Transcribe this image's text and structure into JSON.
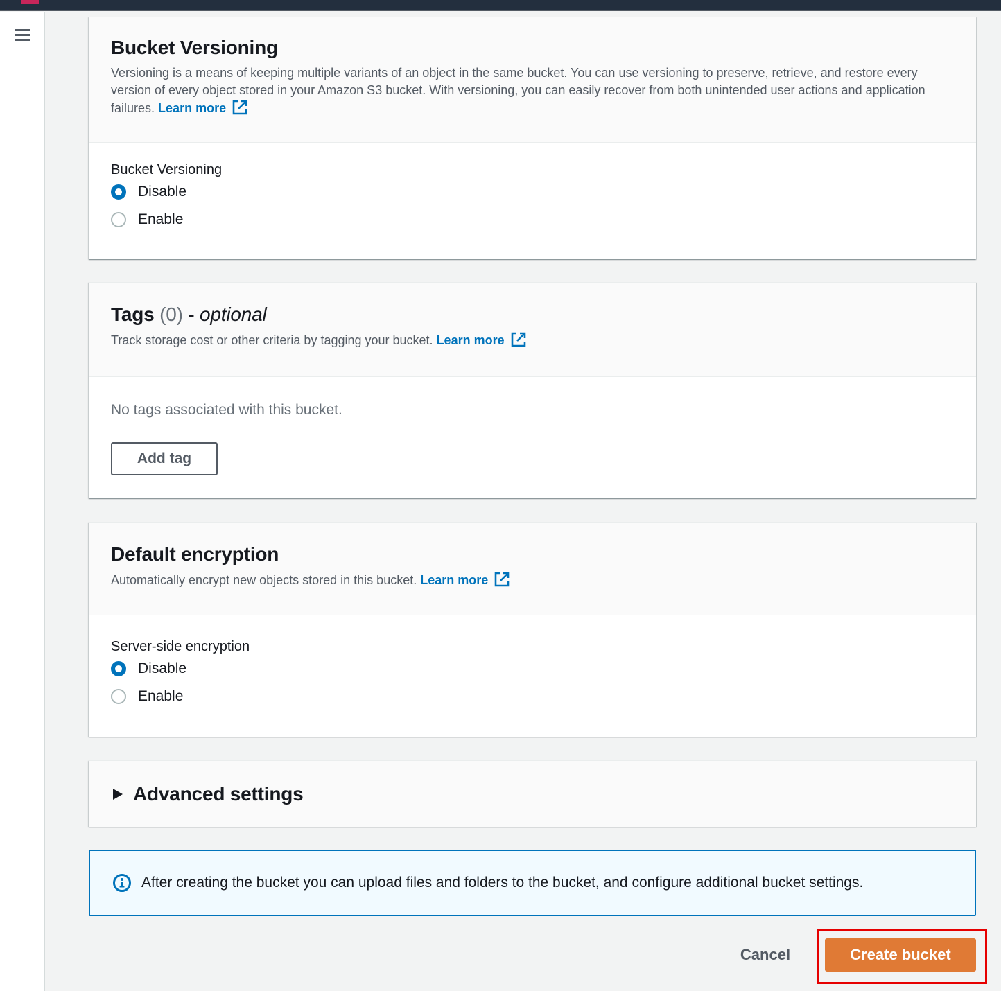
{
  "topbar": {
    "logo": "aws-logo"
  },
  "sidebar": {
    "menu_icon": "hamburger-menu-icon"
  },
  "versioning": {
    "title": "Bucket Versioning",
    "description": "Versioning is a means of keeping multiple variants of an object in the same bucket. You can use versioning to preserve, retrieve, and restore every version of every object stored in your Amazon S3 bucket. With versioning, you can easily recover from both unintended user actions and application failures.",
    "learn_more": "Learn more",
    "field_label": "Bucket Versioning",
    "options": [
      {
        "label": "Disable",
        "checked": true
      },
      {
        "label": "Enable",
        "checked": false
      }
    ]
  },
  "tags": {
    "title": "Tags",
    "count": "(0)",
    "separator": "-",
    "optional": "optional",
    "description": "Track storage cost or other criteria by tagging your bucket.",
    "learn_more": "Learn more",
    "empty_text": "No tags associated with this bucket.",
    "add_button": "Add tag"
  },
  "encryption": {
    "title": "Default encryption",
    "description": "Automatically encrypt new objects stored in this bucket.",
    "learn_more": "Learn more",
    "field_label": "Server-side encryption",
    "options": [
      {
        "label": "Disable",
        "checked": true
      },
      {
        "label": "Enable",
        "checked": false
      }
    ]
  },
  "advanced": {
    "title": "Advanced settings",
    "expanded": false
  },
  "info_alert": {
    "text": "After creating the bucket you can upload files and folders to the bucket, and configure additional bucket settings."
  },
  "actions": {
    "cancel": "Cancel",
    "create": "Create bucket"
  },
  "colors": {
    "primary": "#0073bb",
    "create_button": "#e07a35",
    "highlight": "#e60000",
    "topbar": "#232f3e"
  }
}
